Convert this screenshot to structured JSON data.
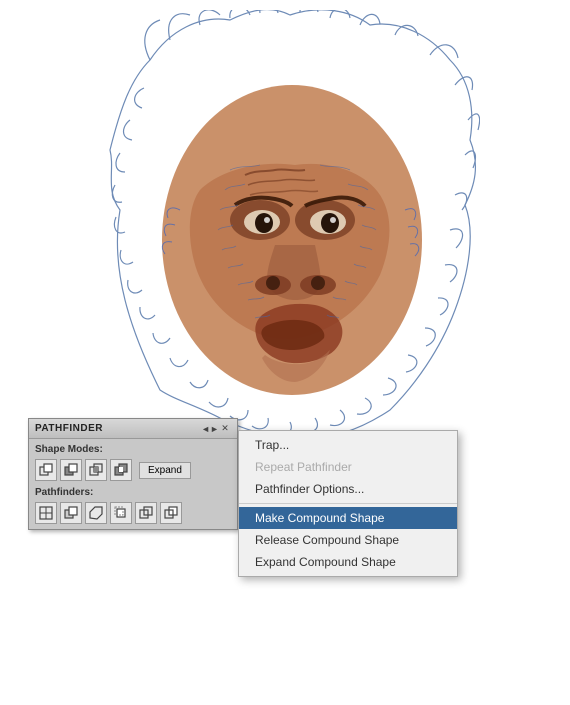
{
  "panel": {
    "title": "PATHFINDER",
    "shape_modes_label": "Shape Modes:",
    "pathfinders_label": "Pathfinders:",
    "expand_button": "Expand",
    "minimize_symbol": "◄►",
    "close_symbol": "✕"
  },
  "context_menu": {
    "items": [
      {
        "id": "trap",
        "label": "Trap...",
        "disabled": false,
        "highlighted": false
      },
      {
        "id": "repeat",
        "label": "Repeat Pathfinder",
        "disabled": true,
        "highlighted": false
      },
      {
        "id": "options",
        "label": "Pathfinder Options...",
        "disabled": false,
        "highlighted": false
      },
      {
        "id": "separator1",
        "type": "separator"
      },
      {
        "id": "make-compound",
        "label": "Make Compound Shape",
        "disabled": false,
        "highlighted": true
      },
      {
        "id": "release-compound",
        "label": "Release Compound Shape",
        "disabled": false,
        "highlighted": false
      },
      {
        "id": "expand-compound",
        "label": "Expand Compound Shape",
        "disabled": false,
        "highlighted": false
      }
    ]
  },
  "illustration": {
    "alt": "Ape face illustration with blue sketch lines"
  }
}
